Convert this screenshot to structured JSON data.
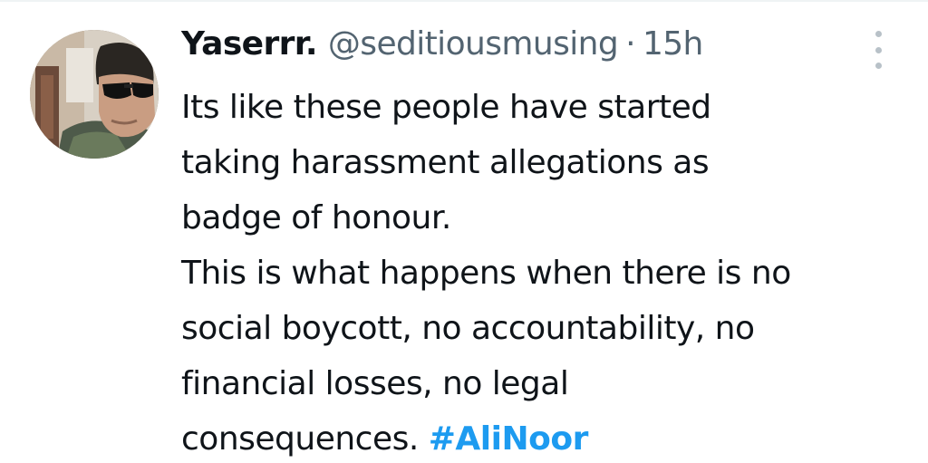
{
  "tweet": {
    "display_name": "Yaserrr.",
    "handle": "@seditiousmusing",
    "separator": "·",
    "time": "15h",
    "lines": [
      "Its like these people have started",
      "taking harassment allegations as",
      "badge of honour.",
      "This is what happens when there is no",
      "social boycott, no accountability, no",
      "financial losses, no legal"
    ],
    "last_line_text": "consequences. ",
    "hashtag": "#AliNoor"
  },
  "icons": {
    "avatar": "profile-photo",
    "more": "more-vertical-icon"
  },
  "colors": {
    "text": "#0f1419",
    "secondary": "#536471",
    "link": "#1d9bf0",
    "icon": "#b8c1c8"
  }
}
